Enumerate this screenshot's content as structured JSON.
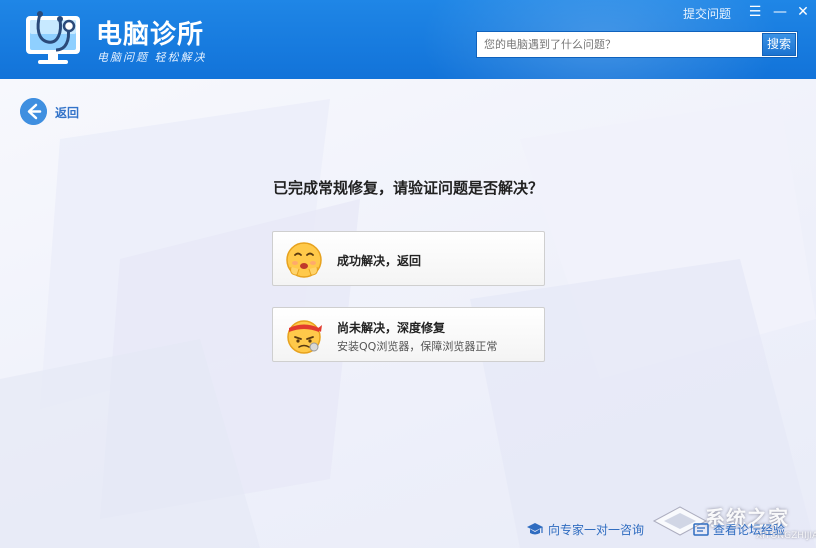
{
  "header": {
    "title": "电脑诊所",
    "slogan": "电脑问题 轻松解决",
    "report_link": "提交问题",
    "search": {
      "placeholder": "您的电脑遇到了什么问题？",
      "button_label": "搜索"
    },
    "window_controls": {
      "menu": "☰",
      "minimize": "—",
      "close": "✕"
    }
  },
  "nav": {
    "back_label": "返回"
  },
  "main": {
    "question": "已完成常规修复，请验证问题是否解决？",
    "options": [
      {
        "title": "成功解决，返回",
        "icon": "smiling-face-icon"
      },
      {
        "title": "尚未解决，深度修复",
        "subtitle": "安装QQ浏览器，保障浏览器正常",
        "icon": "worried-face-icon"
      }
    ]
  },
  "footer": {
    "expert_link": "向专家一对一咨询",
    "forum_link": "查看论坛经验"
  },
  "watermark": {
    "name": "系统之家",
    "url": "XITONGZHIJIA.NET"
  },
  "colors": {
    "header_blue": "#1273d9",
    "link_blue": "#2f6cc0",
    "back_circle": "#3f8fe0"
  }
}
